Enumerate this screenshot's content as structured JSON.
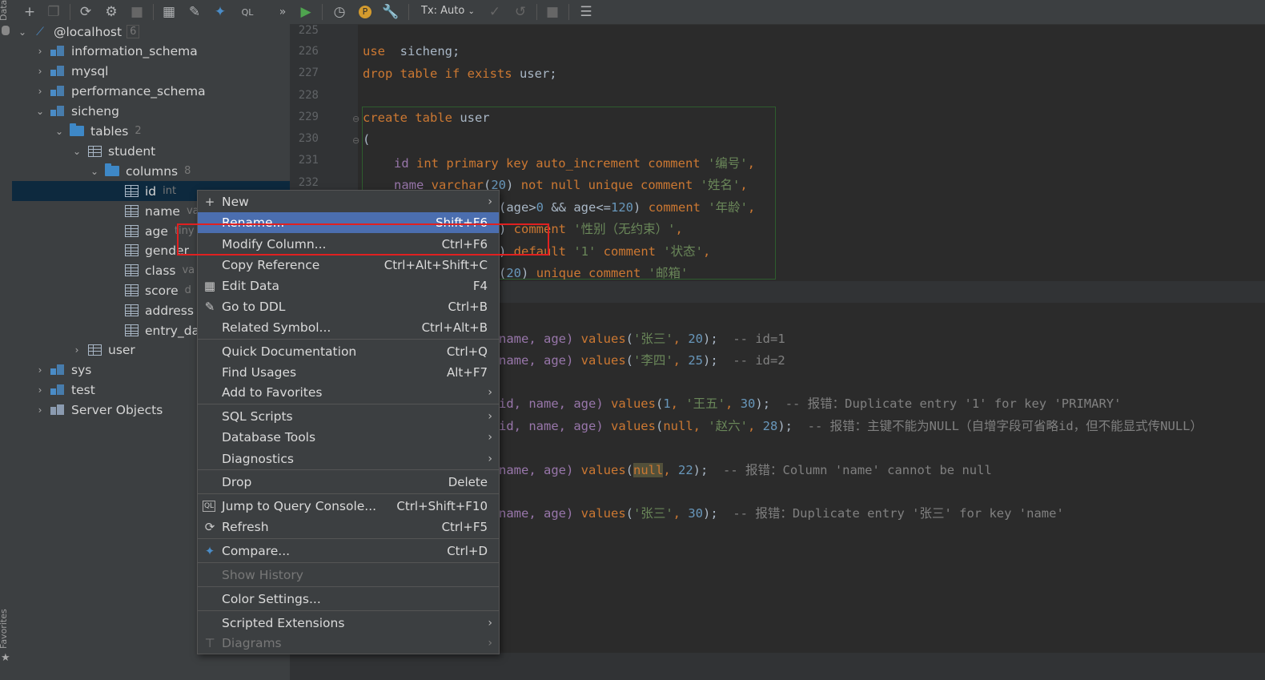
{
  "left_strip": {
    "top_label": "Data",
    "bottom_label": "Favorites"
  },
  "db_toolbar": {
    "icons": [
      "add-icon",
      "copy-icon",
      "refresh-icon",
      "edit-schema-icon",
      "stop-icon",
      "table-icon",
      "edit-icon",
      "jump-icon",
      "query-console-icon",
      "more-icon"
    ]
  },
  "editor_toolbar": {
    "tx_label": "Tx: Auto"
  },
  "tree": {
    "root": {
      "label": "@localhost",
      "count": "6"
    },
    "items": [
      {
        "label": "information_schema"
      },
      {
        "label": "mysql"
      },
      {
        "label": "performance_schema"
      },
      {
        "label": "sicheng"
      },
      {
        "label": "tables",
        "count": "2"
      },
      {
        "label": "student"
      },
      {
        "label": "columns",
        "count": "8"
      },
      {
        "label": "id",
        "meta": "int"
      },
      {
        "label": "name",
        "meta": "va"
      },
      {
        "label": "age",
        "meta": "tiny"
      },
      {
        "label": "gender"
      },
      {
        "label": "class",
        "meta": "va"
      },
      {
        "label": "score",
        "meta": "d"
      },
      {
        "label": "address"
      },
      {
        "label": "entry_da"
      },
      {
        "label": "user"
      },
      {
        "label": "sys"
      },
      {
        "label": "test"
      },
      {
        "label": "Server Objects"
      }
    ]
  },
  "line_numbers": [
    "225",
    "226",
    "227",
    "228",
    "229",
    "230",
    "231",
    "232"
  ],
  "code": {
    "l226_kw": "use",
    "l226_rest": "  sicheng;",
    "l227_kw1": "drop table if exists",
    "l227_rest": " user;",
    "l229_kw": "create table",
    "l229_rest": " user",
    "l230": "(",
    "l231_a": "id ",
    "l231_b": "int primary key auto_increment comment ",
    "l231_str": "'编号'",
    "l231_end": ",",
    "l232_a": "name ",
    "l232_b": "varchar",
    "l232_c": "(",
    "l232_num": "20",
    "l232_d": ") ",
    "l232_e": "not null unique comment ",
    "l232_str": "'姓名'",
    "l232_end": ",",
    "l233_a": "(age>",
    "l233_n1": "0",
    "l233_b": " && age<=",
    "l233_n2": "120",
    "l233_c": ") ",
    "l233_kw": "comment ",
    "l233_str": "'年龄'",
    "l233_end": ",",
    "l234_a": ") ",
    "l234_kw": "comment ",
    "l234_str": "'性别（无约束）'",
    "l234_end": ",",
    "l235_a": ") ",
    "l235_kw": "default ",
    "l235_str": "'1' ",
    "l235_kw2": "comment ",
    "l235_str2": "'状态'",
    "l235_end": ",",
    "l236_a": "(",
    "l236_n": "20",
    "l236_b": ") ",
    "l236_kw": "unique comment ",
    "l236_str": "'邮箱'",
    "ins1_a": "name, age) ",
    "ins1_kw": "values",
    "ins1_b": "(",
    "ins1_str": "'张三'",
    "ins1_c": ", ",
    "ins1_n": "20",
    "ins1_d": ");  ",
    "ins1_cm": "-- id=1",
    "ins2_a": "name, age) ",
    "ins2_kw": "values",
    "ins2_b": "(",
    "ins2_str": "'李四'",
    "ins2_c": ", ",
    "ins2_n": "25",
    "ins2_d": ");  ",
    "ins2_cm": "-- id=2",
    "ins3_a": "id, name, age) ",
    "ins3_kw": "values",
    "ins3_b": "(",
    "ins3_n1": "1",
    "ins3_c": ", ",
    "ins3_str": "'王五'",
    "ins3_d": ", ",
    "ins3_n2": "30",
    "ins3_e": ");  ",
    "ins3_cm": "-- 报错：Duplicate entry '1' for key 'PRIMARY'",
    "ins4_a": "id, name, age) ",
    "ins4_kw": "values",
    "ins4_b": "(",
    "ins4_null": "null",
    "ins4_c": ", ",
    "ins4_str": "'赵六'",
    "ins4_d": ", ",
    "ins4_n": "28",
    "ins4_e": ");  ",
    "ins4_cm": "-- 报错：主键不能为NULL（自增字段可省略id，但不能显式传NULL）",
    "ins5_a": "name, age) ",
    "ins5_kw": "values",
    "ins5_b": "(",
    "ins5_null": "null",
    "ins5_c": ", ",
    "ins5_n": "22",
    "ins5_d": ");  ",
    "ins5_cm": "-- 报错：Column 'name' cannot be null",
    "ins6_a": "name, age) ",
    "ins6_kw": "values",
    "ins6_b": "(",
    "ins6_str": "'张三'",
    "ins6_c": ", ",
    "ins6_n": "30",
    "ins6_d": ");  ",
    "ins6_cm": "-- 报错：Duplicate entry '张三' for key 'name'"
  },
  "context_menu": {
    "items": [
      {
        "label": "New",
        "shortcut": "",
        "submenu": true,
        "icon": "plus-icon"
      },
      {
        "label": "Rename...",
        "shortcut": "Shift+F6",
        "highlighted": true
      },
      {
        "label": "Modify Column...",
        "shortcut": "Ctrl+F6"
      },
      {
        "label": "Copy Reference",
        "shortcut": "Ctrl+Alt+Shift+C"
      },
      {
        "label": "Edit Data",
        "shortcut": "F4",
        "icon": "table-icon"
      },
      {
        "label": "Go to DDL",
        "shortcut": "Ctrl+B",
        "icon": "pencil-icon"
      },
      {
        "label": "Related Symbol...",
        "shortcut": "Ctrl+Alt+B"
      },
      {
        "label": "Quick Documentation",
        "shortcut": "Ctrl+Q"
      },
      {
        "label": "Find Usages",
        "shortcut": "Alt+F7"
      },
      {
        "label": "Add to Favorites",
        "submenu": true
      },
      {
        "label": "SQL Scripts",
        "submenu": true
      },
      {
        "label": "Database Tools",
        "submenu": true
      },
      {
        "label": "Diagnostics",
        "submenu": true
      },
      {
        "label": "Drop",
        "shortcut": "Delete"
      },
      {
        "label": "Jump to Query Console...",
        "shortcut": "Ctrl+Shift+F10",
        "icon": "query-console-icon"
      },
      {
        "label": "Refresh",
        "shortcut": "Ctrl+F5",
        "icon": "refresh-icon"
      },
      {
        "label": "Compare...",
        "shortcut": "Ctrl+D",
        "icon": "compare-icon"
      },
      {
        "label": "Show History",
        "disabled": true
      },
      {
        "label": "Color Settings..."
      },
      {
        "label": "Scripted Extensions",
        "submenu": true
      },
      {
        "label": "Diagrams",
        "submenu": true,
        "disabled": true,
        "icon": "diagram-icon"
      }
    ]
  },
  "colors": {
    "highlight": "#4b6eaf",
    "annotation_red": "#e02020",
    "keyword": "#cc7832",
    "string": "#6a8759",
    "number": "#6897bb"
  }
}
